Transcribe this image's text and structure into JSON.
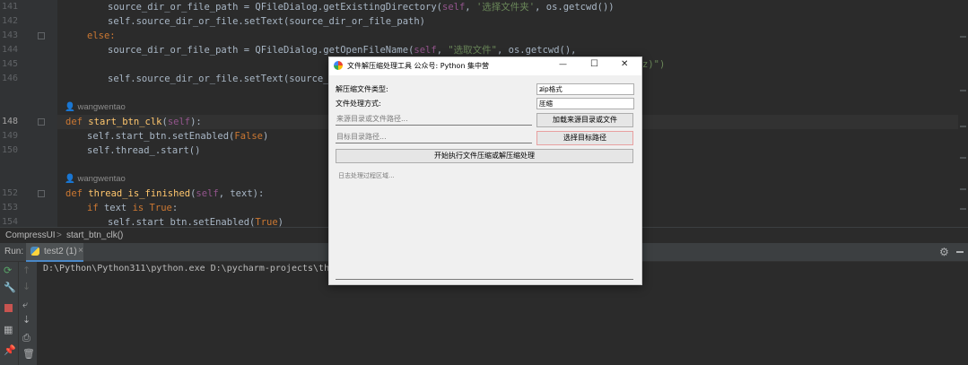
{
  "editor": {
    "line_numbers": [
      "141",
      "142",
      "143",
      "144",
      "145",
      "146",
      "",
      "148",
      "149",
      "150",
      "",
      "152",
      "153",
      "154"
    ],
    "authors": [
      "wangwentao",
      "wangwentao"
    ],
    "lines": {
      "l141": {
        "var": "source_dir_or_file_path",
        "eq": " = ",
        "cls": "QFileDialog",
        "call": ".getExistingDirectory(",
        "self": "self",
        ", ": ", ",
        "s": "'选择文件夹'",
        "rest": ", os.getcwd())"
      },
      "l142": "self.source_dir_or_file.setText(source_dir_or_file_path)",
      "l143": "else:",
      "l144": {
        "var": "source_dir_or_file_path",
        "eq": " = ",
        "cls": "QFileDialog",
        "call": ".getOpenFileName(",
        "self": "self",
        ", ": ", ",
        "s": "\"选取文件\"",
        "rest": ", os.getcwd(),"
      },
      "l145_tail": "z)\")",
      "l146": "self.source_dir_or_file.setText(source_dir",
      "l148": {
        "def": "def ",
        "name": "start_btn_clk",
        "open": "(",
        "self": "self",
        "close": "):"
      },
      "l149": {
        "pre": "self.start_btn.setEnabled(",
        "val": "False",
        "post": ")"
      },
      "l150": "self.thread_.start()",
      "l152": {
        "def": "def ",
        "name": "thread_is_finished",
        "open": "(",
        "self": "self",
        "close": ", text):"
      },
      "l153": {
        "kw1": "if ",
        "mid": "text ",
        "kw2": "is ",
        "val": "True",
        ":": ":"
      },
      "l154": {
        "pre": "self.start_btn.setEnabled(",
        "val": "True",
        "post": ")"
      }
    }
  },
  "breadcrumb": {
    "class": "CompressUI",
    "sep": ">",
    "method": "start_btn_clk()"
  },
  "run": {
    "label": "Run:",
    "tab": "test2 (1)",
    "tab_close": "×",
    "console_line": "D:\\Python\\Python311\\python.exe D:\\pycharm-projects\\the-"
  },
  "dialog": {
    "title": "文件解压缩处理工具 公众号: Python 集中营",
    "minimize": "—",
    "maximize": "☐",
    "close": "✕",
    "type_label": "解压缩文件类型:",
    "type_value": "zip格式",
    "mode_label": "文件处理方式:",
    "mode_value": "压缩",
    "source_placeholder": "来源目录或文件路径...",
    "load_button": "加载来源目录或文件",
    "target_placeholder": "目标目录路径...",
    "target_button": "选择目标路径",
    "start_button": "开始执行文件压缩或解压缩处理",
    "log_placeholder": "日志处理过程区域..."
  },
  "colors": {
    "editor_bg": "#2b2b2b",
    "keyword": "#cc7832",
    "function": "#ffc66d",
    "string": "#6a8759",
    "self": "#94558d"
  },
  "icons": [
    "rerun-icon",
    "wrench-icon",
    "stop-icon",
    "layout-icon",
    "pin-icon",
    "up-arrow-icon",
    "down-arrow-icon",
    "wrap-icon",
    "sort-icon",
    "print-icon",
    "trash-icon",
    "gear-icon",
    "minimize-icon",
    "python-icon",
    "app-logo-icon"
  ]
}
